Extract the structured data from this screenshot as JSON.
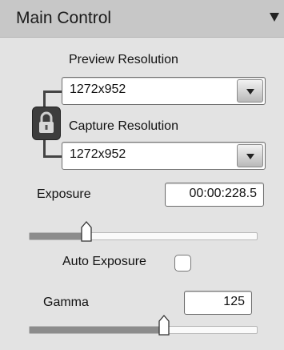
{
  "header": {
    "title": "Main Control"
  },
  "preview": {
    "label": "Preview Resolution",
    "value": "1272x952"
  },
  "capture": {
    "label": "Capture Resolution",
    "value": "1272x952"
  },
  "exposure": {
    "label": "Exposure",
    "value": "00:00:228.5",
    "slider_level": 0.25
  },
  "auto_exposure": {
    "label": "Auto Exposure",
    "checked": false
  },
  "gamma": {
    "label": "Gamma",
    "value": "125",
    "slider_level": 0.59
  },
  "icons": [
    "chevron-down-icon",
    "lock-icon",
    "dropdown-arrow-icon",
    "slider-thumb-icon"
  ]
}
